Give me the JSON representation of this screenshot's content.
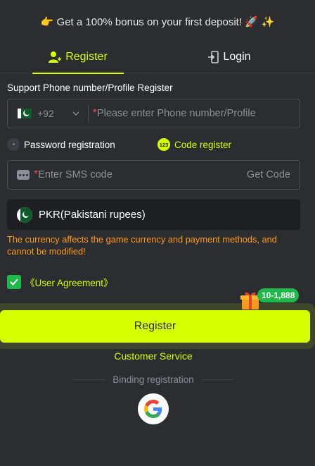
{
  "promo": {
    "left_emoji": "👉",
    "text": "Get a 100% bonus on your first deposit!",
    "right_emoji": "🚀 ✨"
  },
  "tabs": [
    {
      "label": "Register",
      "active": true,
      "icon": "add-user-icon"
    },
    {
      "label": "Login",
      "active": false,
      "icon": "login-door-icon"
    }
  ],
  "phone": {
    "section_label": "Support Phone number/Profile Register",
    "country_code": "+92",
    "required_mark": "*",
    "placeholder": "Please enter Phone number/Profile"
  },
  "modes": {
    "password_label": "Password registration",
    "code_label": "Code register",
    "code_icon_text": "123"
  },
  "sms": {
    "required_mark": "*",
    "placeholder": "Enter SMS code",
    "get_code": "Get Code"
  },
  "currency": {
    "value": "PKR(Pakistani rupees)",
    "warning": "The currency affects the game currency and payment methods, and cannot be modified!"
  },
  "agreement": {
    "checked": true,
    "label": "《User Agreement》"
  },
  "register_button": "Register",
  "bonus_badge": "10-1,888",
  "customer_service": "Customer Service",
  "binding_label": "Binding registration",
  "colors": {
    "background": "#2b2d31",
    "accent": "#d6ff00",
    "warning": "#ff9b1a",
    "success": "#1fb84a"
  }
}
